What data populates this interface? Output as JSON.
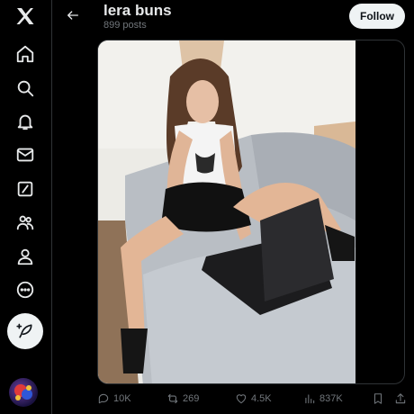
{
  "sidebar": {
    "items": [
      {
        "name": "x-logo-icon"
      },
      {
        "name": "home-icon"
      },
      {
        "name": "search-icon"
      },
      {
        "name": "notifications-icon"
      },
      {
        "name": "messages-icon"
      },
      {
        "name": "grok-icon"
      },
      {
        "name": "communities-icon"
      },
      {
        "name": "profile-icon"
      },
      {
        "name": "more-icon"
      }
    ],
    "compose_icon": "feather-plus-icon"
  },
  "header": {
    "back_icon": "arrow-left-icon",
    "name": "lera buns",
    "post_count": "899 posts",
    "follow_label": "Follow"
  },
  "media": {
    "description_icon": "photo"
  },
  "actions": {
    "replies": "10K",
    "reposts": "269",
    "likes": "4.5K",
    "views": "837K"
  },
  "colors": {
    "background": "#000000",
    "text": "#e7e9ea",
    "muted": "#71767b",
    "button_bg": "#eff3f4",
    "border": "#2f3336"
  }
}
